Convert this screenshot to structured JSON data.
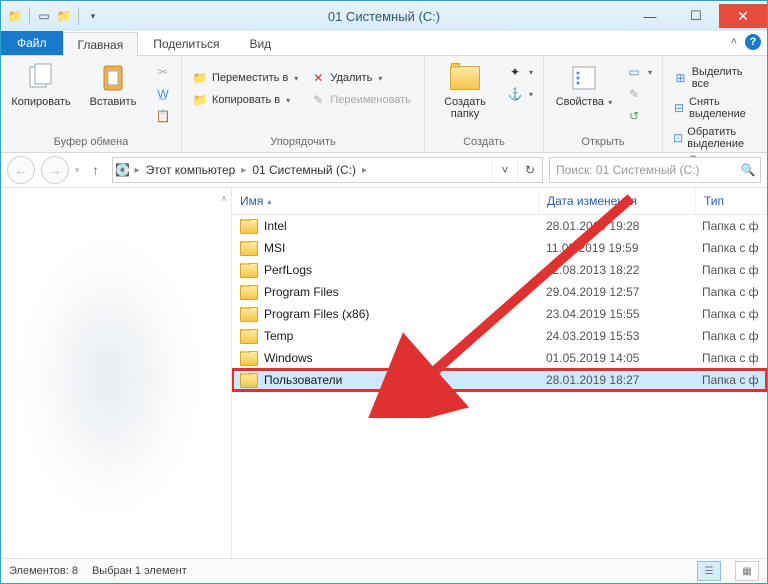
{
  "window": {
    "title": "01 Системный (C:)"
  },
  "tabs": {
    "file": "Файл",
    "home": "Главная",
    "share": "Поделиться",
    "view": "Вид"
  },
  "ribbon": {
    "clipboard": {
      "copy": "Копировать",
      "paste": "Вставить",
      "group": "Буфер обмена"
    },
    "organize": {
      "moveTo": "Переместить в",
      "copyTo": "Копировать в",
      "delete": "Удалить",
      "rename": "Переименовать",
      "group": "Упорядочить"
    },
    "new": {
      "newFolder": "Создать папку",
      "group": "Создать"
    },
    "open": {
      "properties": "Свойства",
      "group": "Открыть"
    },
    "select": {
      "selectAll": "Выделить все",
      "selectNone": "Снять выделение",
      "invert": "Обратить выделение",
      "group": "Выделить"
    }
  },
  "breadcrumb": {
    "root": "Этот компьютер",
    "drive": "01 Системный (C:)"
  },
  "search": {
    "placeholder": "Поиск: 01 Системный (C:)"
  },
  "columns": {
    "name": "Имя",
    "date": "Дата изменения",
    "type": "Тип"
  },
  "typeLabel": "Папка с ф",
  "items": [
    {
      "name": "Intel",
      "date": "28.01.2019 19:28"
    },
    {
      "name": "MSI",
      "date": "11.02.2019 19:59"
    },
    {
      "name": "PerfLogs",
      "date": "22.08.2013 18:22"
    },
    {
      "name": "Program Files",
      "date": "29.04.2019 12:57"
    },
    {
      "name": "Program Files (x86)",
      "date": "23.04.2019 15:55"
    },
    {
      "name": "Temp",
      "date": "24.03.2019 15:53"
    },
    {
      "name": "Windows",
      "date": "01.05.2019 14:05"
    },
    {
      "name": "Пользователи",
      "date": "28.01.2019 18:27"
    }
  ],
  "selectedIndex": 7,
  "status": {
    "count": "Элементов: 8",
    "selected": "Выбран 1 элемент"
  }
}
